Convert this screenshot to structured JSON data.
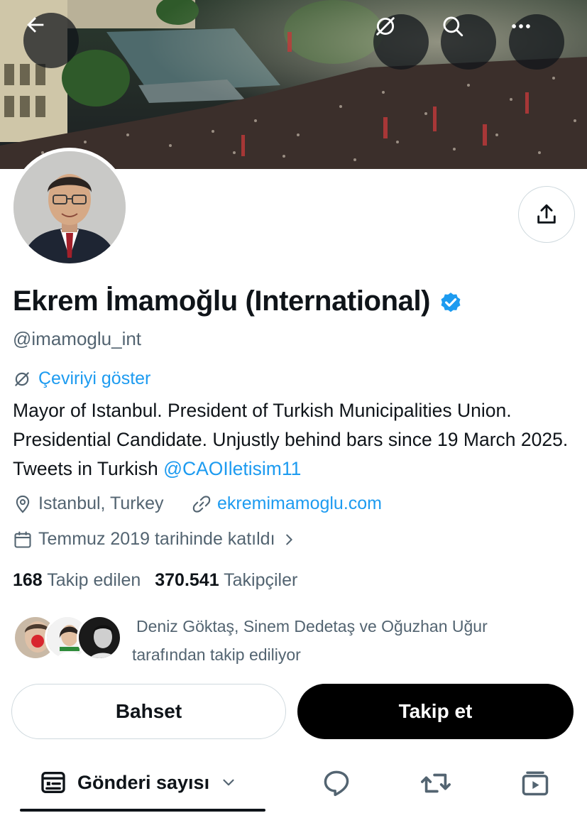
{
  "header": {
    "back_icon": "arrow-left-icon",
    "translate_icon": "translate-off-icon",
    "search_icon": "search-icon",
    "more_icon": "more-horizontal-icon"
  },
  "profile": {
    "display_name": "Ekrem İmamoğlu (International)",
    "verified": true,
    "handle": "@imamoglu_int",
    "translate_label": "Çeviriyi göster",
    "bio_text": "Mayor of Istanbul. President of Turkish Municipalities Union. Presidential Candidate. Unjustly behind bars since 19 March 2025. Tweets in Turkish ",
    "bio_mention": "@CAOIletisim11",
    "location": "Istanbul, Turkey",
    "website": "ekremimamoglu.com",
    "joined": "Temmuz 2019 tarihinde katıldı"
  },
  "stats": {
    "following_count": "168",
    "following_label": "Takip edilen",
    "followers_count": "370.541",
    "followers_label": "Takipçiler"
  },
  "followed_by": {
    "line1": "Deniz Göktaş,  Sinem Dedetaş ve Oğuzhan Uğur",
    "line2": "tarafından takip ediliyor"
  },
  "actions": {
    "mention_label": "Bahset",
    "follow_label": "Takip et"
  },
  "tabs": {
    "posts_label": "Gönderi sayısı"
  },
  "colors": {
    "accent": "#1d9bf0",
    "text": "#0f1419",
    "secondary": "#536471"
  }
}
